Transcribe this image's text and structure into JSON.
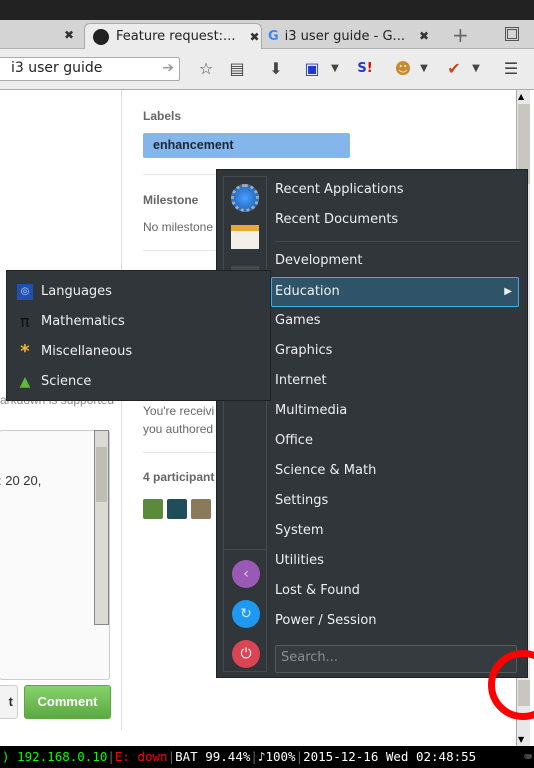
{
  "browser": {
    "tabs": [
      {
        "label": "Feature request:...",
        "icon": "github-icon",
        "active": true
      },
      {
        "label": "i3 user guide - G...",
        "icon": "google-icon",
        "active": false
      }
    ],
    "url": "i3 user guide"
  },
  "sidebar": {
    "labels_heading": "Labels",
    "label": "enhancement",
    "label_color": "#84b6eb",
    "milestone_heading": "Milestone",
    "milestone_value": "No milestone",
    "notify_line1": "You're receivi",
    "notify_line2": "you authored",
    "participants": "4 participant"
  },
  "comment": {
    "markdown_note": "arkdown is supported",
    "text_fragment": ": 20 20,",
    "other_button": "t",
    "comment_button": "Comment"
  },
  "menu": {
    "items": [
      "Recent Applications",
      "Recent Documents",
      "Development",
      "Education",
      "Games",
      "Graphics",
      "Internet",
      "Multimedia",
      "Office",
      "Science & Math",
      "Settings",
      "System",
      "Utilities",
      "Lost & Found",
      "Power / Session"
    ],
    "selected": "Education",
    "search_placeholder": "Search...",
    "submenu": [
      {
        "label": "Languages",
        "icon": "languages-icon"
      },
      {
        "label": "Mathematics",
        "icon": "pi-icon"
      },
      {
        "label": "Miscellaneous",
        "icon": "asterisk-icon"
      },
      {
        "label": "Science",
        "icon": "flask-icon"
      }
    ]
  },
  "statusbar": {
    "prefix": ")",
    "ip": "192.168.0.10",
    "eth": "E: down",
    "bat": "BAT 99.44%",
    "vol": "♪100%",
    "datetime": "2015-12-16 Wed 02:48:55"
  }
}
